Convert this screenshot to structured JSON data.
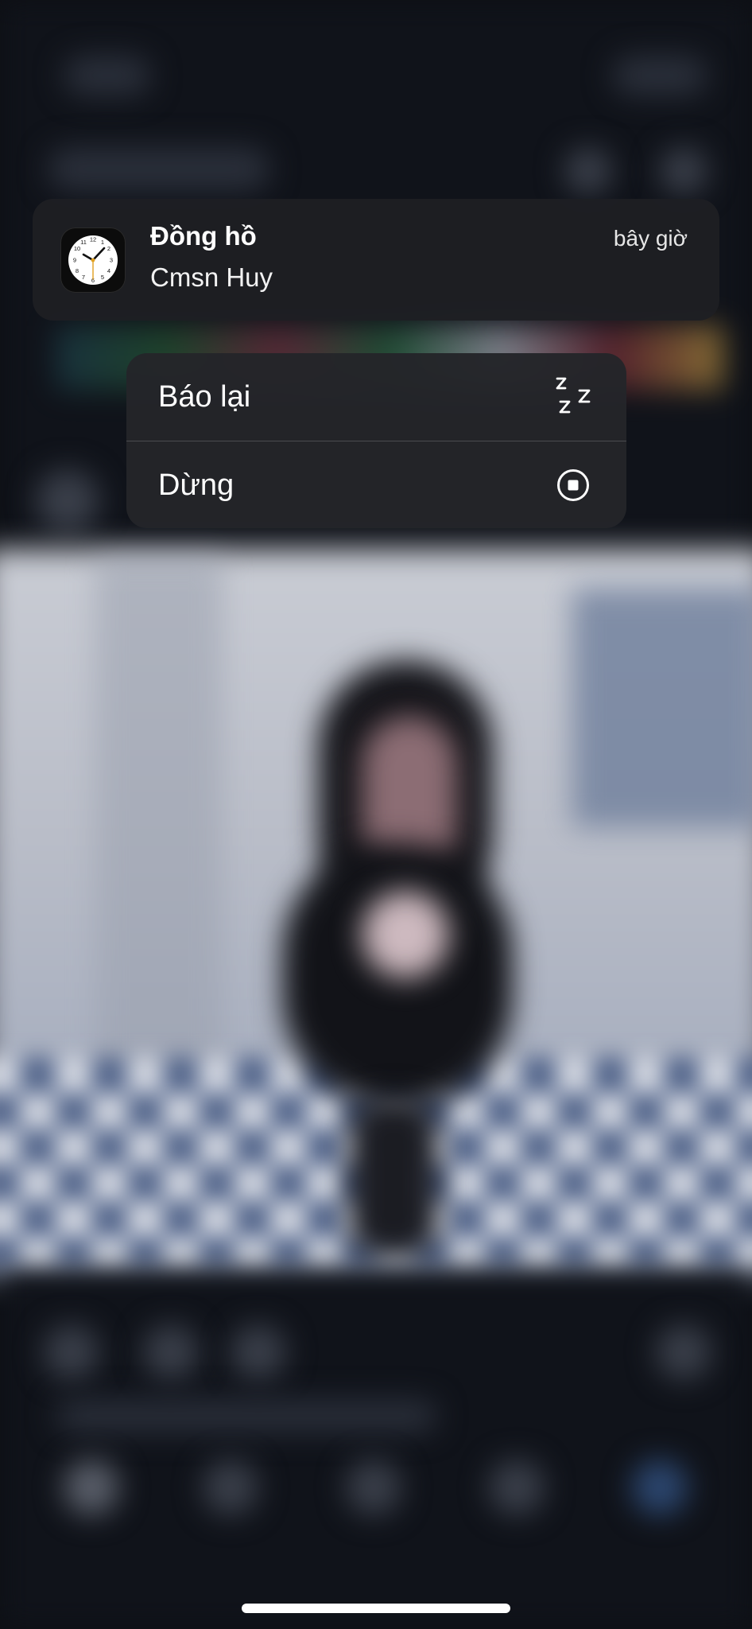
{
  "notification": {
    "app_name": "Đồng hồ",
    "message": "Cmsn Huy",
    "time": "bây giờ",
    "app_icon": "clock-icon"
  },
  "menu": {
    "snooze_label": "Báo lại",
    "snooze_icon": "zzz-icon",
    "stop_label": "Dừng",
    "stop_icon": "stop-circle-icon"
  },
  "colors": {
    "notification_bg": "#1e1f23",
    "menu_bg": "#242529",
    "text": "#ffffff",
    "clock_hand_accent": "#e0a020"
  }
}
